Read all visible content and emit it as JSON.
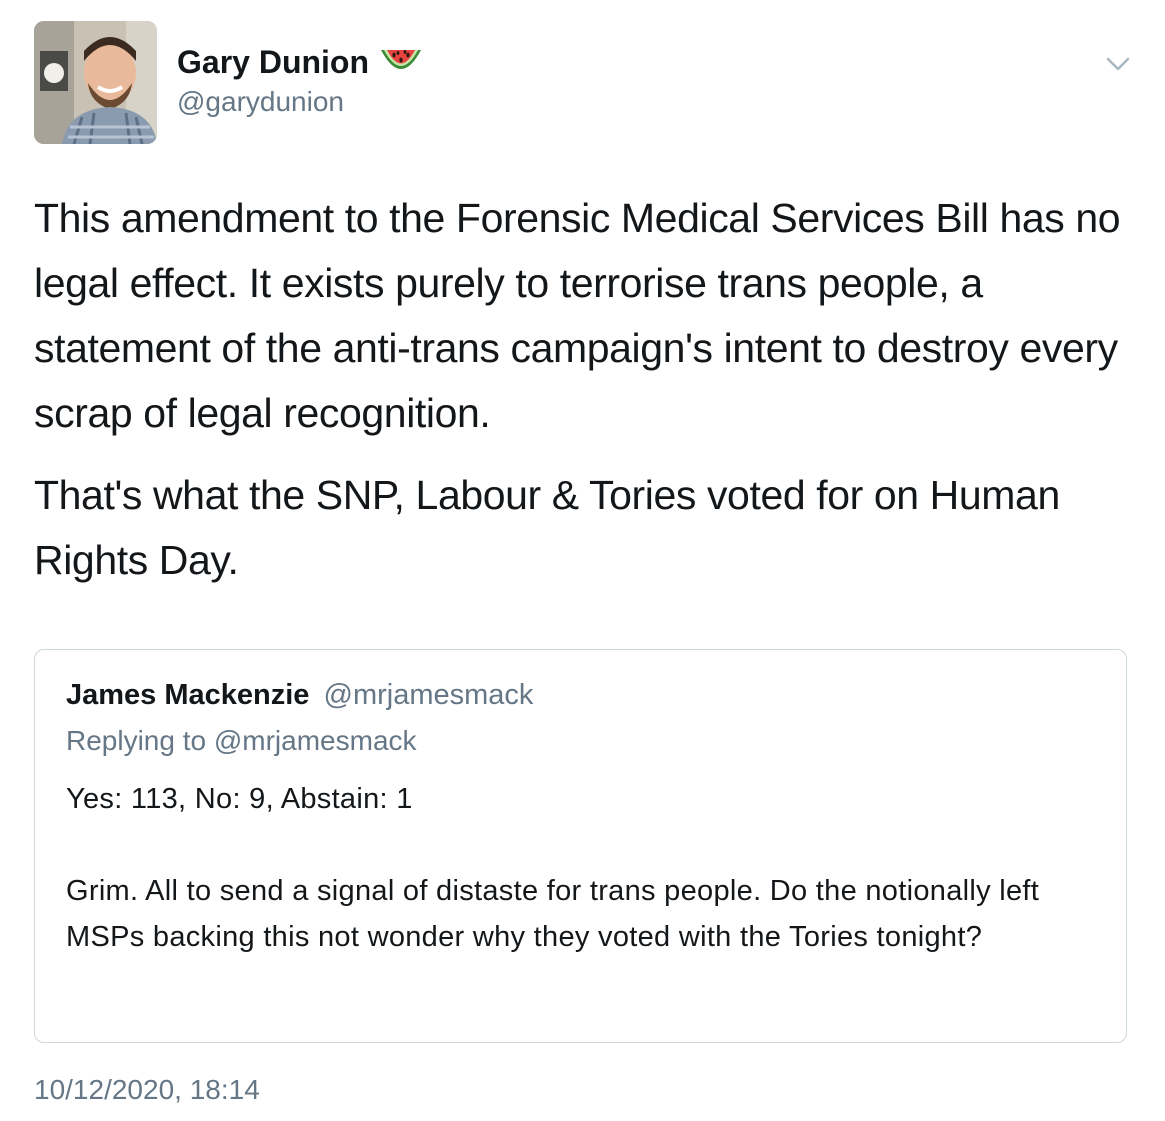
{
  "author": {
    "display_name": "Gary Dunion",
    "handle": "@garydunion",
    "name_emoji": "watermelon-icon",
    "avatar": "avatar-photo"
  },
  "menu_icon": "chevron-down-icon",
  "tweet": {
    "paragraphs": [
      "This amendment to the Forensic Medical Services Bill has no legal effect. It exists purely to terrorise trans people, a statement of the anti-trans campaign's intent to destroy every scrap of legal recognition.",
      "That's what the SNP, Labour & Tories voted for on Human Rights Day."
    ],
    "timestamp": "10/12/2020, 18:14"
  },
  "quoted_tweet": {
    "display_name": "James Mackenzie",
    "handle": "@mrjamesmack",
    "replying_to": "Replying to @mrjamesmack",
    "line1": "Yes: 113, No: 9, Abstain: 1",
    "line2": "Grim. All to send a signal of distaste for trans people. Do the notionally left MSPs backing this not wonder why they voted with the Tories tonight?"
  },
  "colors": {
    "text": "#14171a",
    "secondary": "#657786",
    "border": "#ccd6dd"
  }
}
